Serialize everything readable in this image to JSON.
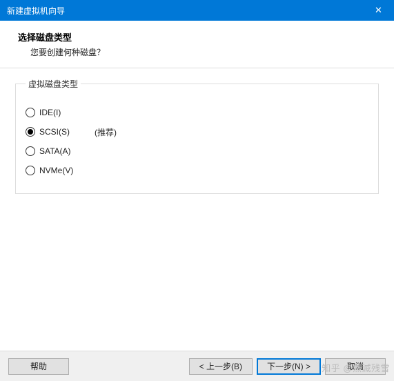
{
  "titlebar": {
    "title": "新建虚拟机向导",
    "close_symbol": "✕"
  },
  "header": {
    "title": "选择磁盘类型",
    "subtitle": "您要创建何种磁盘？"
  },
  "fieldset": {
    "legend": "虚拟磁盘类型"
  },
  "options": [
    {
      "label": "IDE(I)",
      "hint": "",
      "checked": false
    },
    {
      "label": "SCSI(S)",
      "hint": "(推荐)",
      "checked": true
    },
    {
      "label": "SATA(A)",
      "hint": "",
      "checked": false
    },
    {
      "label": "NVMe(V)",
      "hint": "",
      "checked": false
    }
  ],
  "footer": {
    "help": "帮助",
    "back": "< 上一步(B)",
    "next": "下一步(N) >",
    "cancel": "取消"
  },
  "watermark": "知乎 @黙滅残雪"
}
